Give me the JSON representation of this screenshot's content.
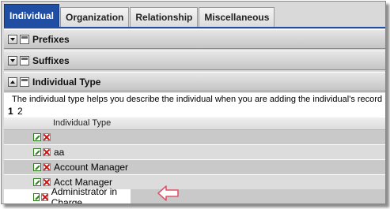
{
  "tabs": [
    {
      "label": "Individual",
      "active": true
    },
    {
      "label": "Organization",
      "active": false
    },
    {
      "label": "Relationship",
      "active": false
    },
    {
      "label": "Miscellaneous",
      "active": false
    }
  ],
  "sections": {
    "prefixes": {
      "title": "Prefixes",
      "state": "collapsed"
    },
    "suffixes": {
      "title": "Suffixes",
      "state": "collapsed"
    },
    "individual_type": {
      "title": "Individual Type",
      "state": "expanded"
    }
  },
  "description": "The individual type helps you describe the individual when you are adding the individual's record",
  "pager": {
    "current": "1",
    "next": "2"
  },
  "table": {
    "header": "Individual Type",
    "rows": [
      {
        "label": ""
      },
      {
        "label": "aa"
      },
      {
        "label": "Account Manager"
      },
      {
        "label": "Acct Manager"
      },
      {
        "label": "Administrator in Charge",
        "highlighted": true
      }
    ]
  },
  "colors": {
    "tab_active": "#1f4ea3",
    "row_odd": "#c9c9c9",
    "row_even": "#dcdcdc",
    "arrow_outline": "#e0556a"
  },
  "icons": {
    "edit": "edit-icon",
    "delete": "delete-icon",
    "expand": "chevron-down-icon",
    "collapse": "chevron-up-icon",
    "pointer": "arrow-left-icon"
  }
}
